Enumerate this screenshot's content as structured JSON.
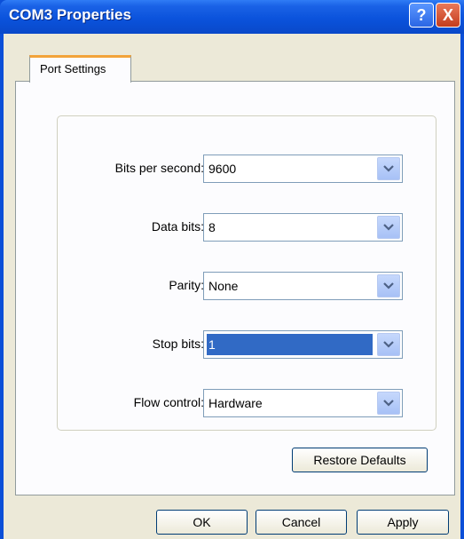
{
  "window": {
    "title": "COM3 Properties"
  },
  "titlebar_buttons": {
    "help": "?",
    "close": "X"
  },
  "tabs": [
    {
      "label": "Port Settings",
      "selected": true
    }
  ],
  "port_settings": {
    "bits_per_second": {
      "label": "Bits per second:",
      "value": "9600"
    },
    "data_bits": {
      "label": "Data bits:",
      "value": "8"
    },
    "parity": {
      "label": "Parity:",
      "value": "None"
    },
    "stop_bits": {
      "label": "Stop bits:",
      "value": "1"
    },
    "flow_control": {
      "label": "Flow control:",
      "value": "Hardware"
    },
    "restore_defaults": "Restore Defaults"
  },
  "footer": {
    "ok": "OK",
    "cancel": "Cancel",
    "apply": "Apply"
  },
  "colors": {
    "titlebar": "#0b53dc",
    "face": "#ece9d8",
    "selection": "#316ac5",
    "tab_accent": "#f2a33a"
  }
}
